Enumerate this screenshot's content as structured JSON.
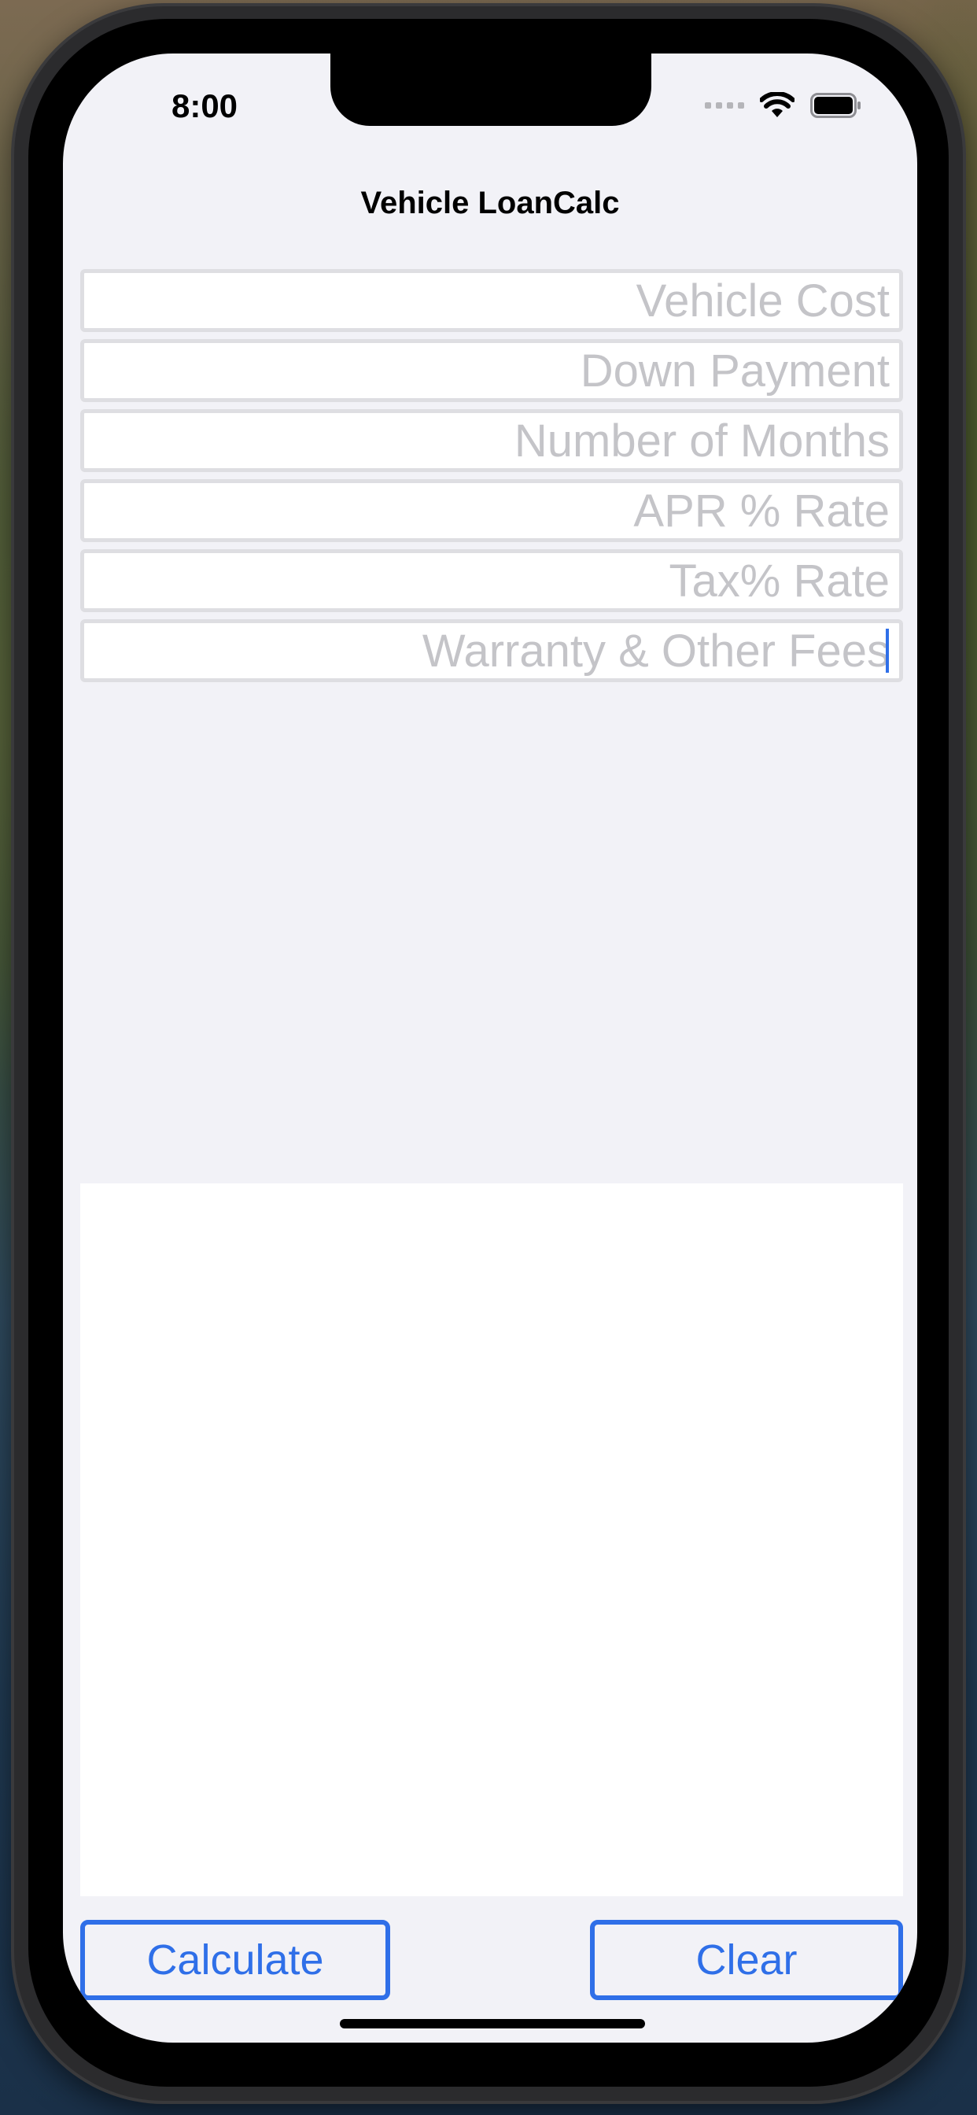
{
  "status_bar": {
    "time": "8:00",
    "icons": [
      "cellular-signal-icon",
      "wifi-icon",
      "battery-icon"
    ]
  },
  "nav": {
    "title": "Vehicle LoanCalc"
  },
  "form": {
    "fields": [
      {
        "placeholder": "Vehicle Cost",
        "value": ""
      },
      {
        "placeholder": "Down Payment",
        "value": ""
      },
      {
        "placeholder": "Number of Months",
        "value": ""
      },
      {
        "placeholder": "APR % Rate",
        "value": ""
      },
      {
        "placeholder": "Tax% Rate",
        "value": ""
      },
      {
        "placeholder": "Warranty & Other Fees",
        "value": ""
      }
    ],
    "focused_field_index": 5
  },
  "result": {
    "text": ""
  },
  "buttons": {
    "calculate_label": "Calculate",
    "clear_label": "Clear"
  },
  "colors": {
    "accent": "#2f6fe8",
    "background": "#f2f2f7",
    "field_border": "#dedee2",
    "placeholder": "#c4c4c8"
  }
}
